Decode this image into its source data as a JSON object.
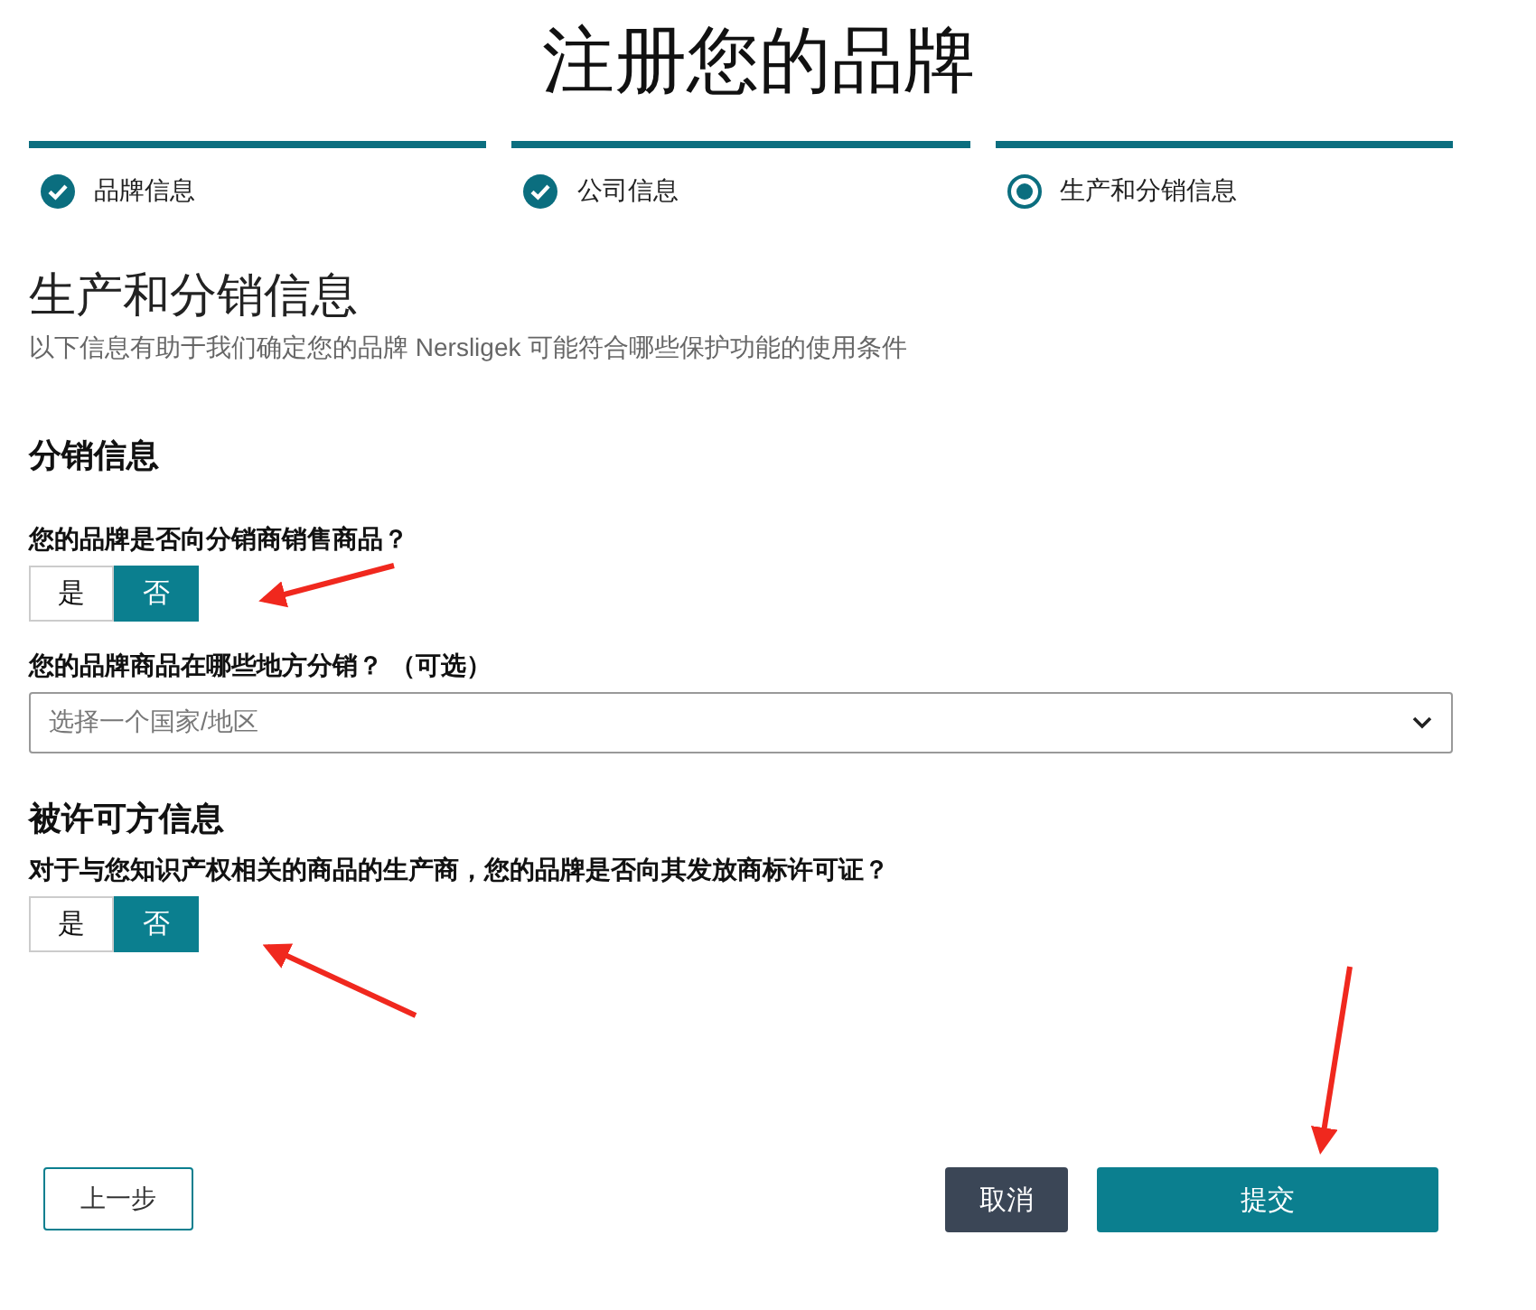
{
  "title": "注册您的品牌",
  "steps": [
    {
      "label": "品牌信息",
      "kind": "done",
      "reached": true
    },
    {
      "label": "公司信息",
      "kind": "done",
      "reached": true
    },
    {
      "label": "生产和分销信息",
      "kind": "current",
      "reached": true
    }
  ],
  "heading": "生产和分销信息",
  "subtitle": "以下信息有助于我们确定您的品牌 Nersligek 可能符合哪些保护功能的使用条件",
  "sections": [
    {
      "title": "分销信息",
      "fields": [
        {
          "kind": "toggle",
          "label": "您的品牌是否向分销商销售商品？",
          "options": [
            {
              "label": "是",
              "selected": false
            },
            {
              "label": "否",
              "selected": true
            }
          ]
        },
        {
          "kind": "select",
          "label": "您的品牌商品在哪些地方分销？ （可选）",
          "placeholder": "选择一个国家/地区"
        }
      ]
    },
    {
      "title": "被许可方信息",
      "fields": [
        {
          "kind": "toggle",
          "label": "对于与您知识产权相关的商品的生产商，您的品牌是否向其发放商标许可证？",
          "options": [
            {
              "label": "是",
              "selected": false
            },
            {
              "label": "否",
              "selected": true
            }
          ]
        }
      ]
    }
  ],
  "buttons": {
    "back": "上一步",
    "cancel": "取消",
    "submit": "提交"
  }
}
